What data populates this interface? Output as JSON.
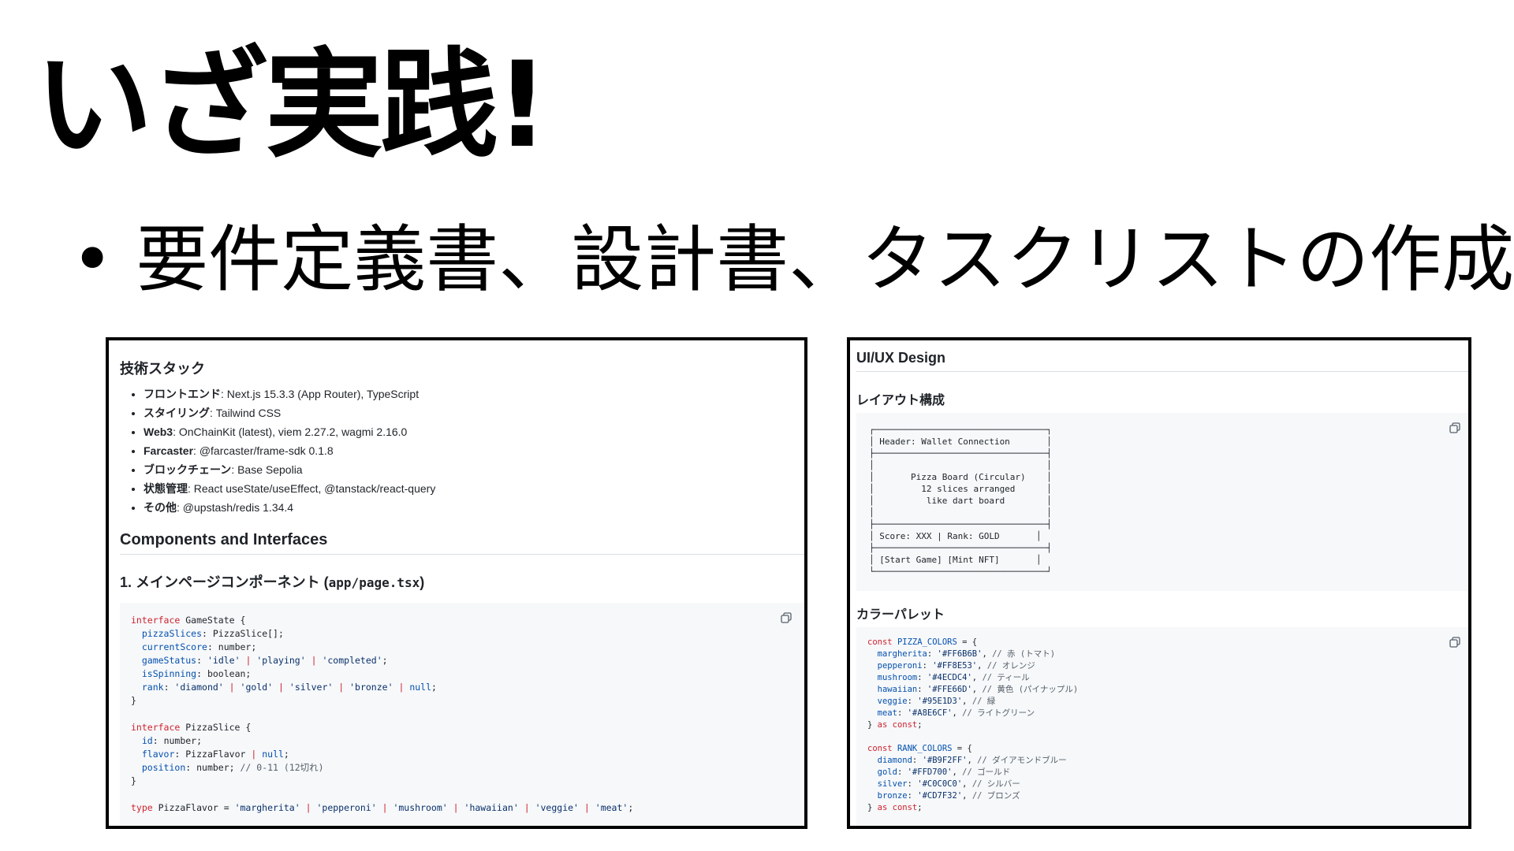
{
  "slide": {
    "title": "いざ実践!",
    "bullet_text": "要件定義書、設計書、タスクリストの作成"
  },
  "left_panel": {
    "heading": "技術スタック",
    "items": [
      {
        "label": "フロントエンド",
        "value": ": Next.js 15.3.3 (App Router), TypeScript"
      },
      {
        "label": "スタイリング",
        "value": ": Tailwind CSS"
      },
      {
        "label": "Web3",
        "value": ": OnChainKit (latest), viem 2.27.2, wagmi 2.16.0"
      },
      {
        "label": "Farcaster",
        "value": ": @farcaster/frame-sdk 0.1.8"
      },
      {
        "label": "ブロックチェーン",
        "value": ": Base Sepolia"
      },
      {
        "label": "状態管理",
        "value": ": React useState/useEffect, @tanstack/react-query"
      },
      {
        "label": "その他",
        "value": ": @upstash/redis 1.34.4"
      }
    ],
    "section_title": "Components and Interfaces",
    "sub_title_prefix": "1. メインページコンポーネント (",
    "sub_title_code": "app/page.tsx",
    "sub_title_suffix": ")"
  },
  "right_panel": {
    "title": "UI/UX Design",
    "layout_heading": "レイアウト構成",
    "palette_heading": "カラーパレット"
  },
  "colors": {
    "keyword": "#cf222e",
    "property": "#0550ae",
    "string": "#0a3069",
    "comment": "#57606a",
    "code_bg": "#f6f8fa"
  },
  "icons": [
    "copy-icon"
  ]
}
